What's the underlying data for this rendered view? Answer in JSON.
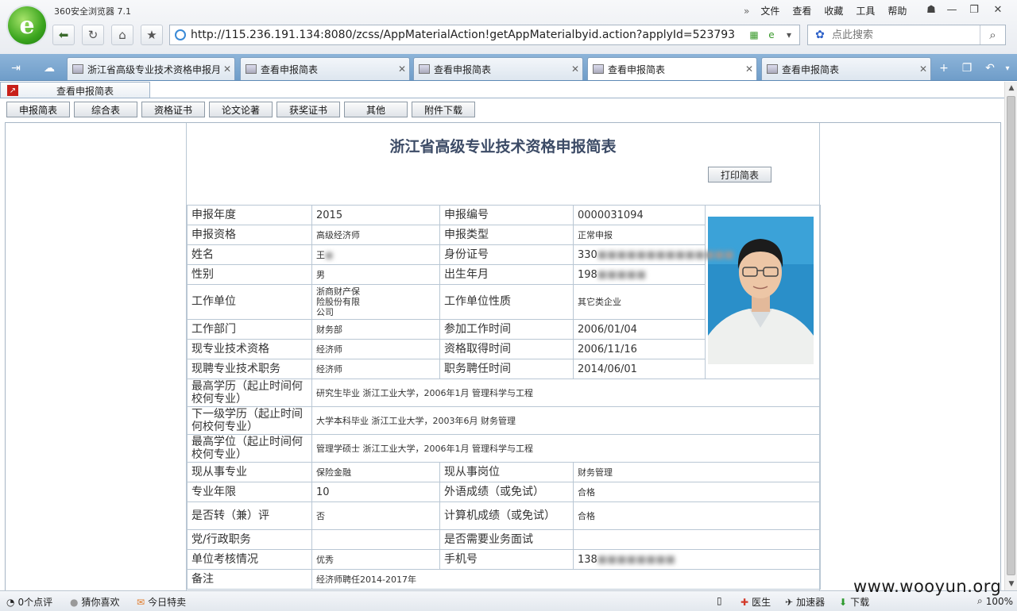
{
  "browser": {
    "app_name": "360安全浏览器 7.1",
    "menu": [
      "文件",
      "查看",
      "收藏",
      "工具",
      "帮助"
    ],
    "address": "http://115.236.191.134:8080/zcss/AppMaterialAction!getAppMaterialbyid.action?applyId=523793",
    "search_placeholder": "点此搜索",
    "tabs": [
      {
        "title": "浙江省高级专业技术资格申报月"
      },
      {
        "title": "查看申报简表"
      },
      {
        "title": "查看申报简表"
      },
      {
        "title": "查看申报简表"
      },
      {
        "title": "查看申报简表"
      }
    ],
    "active_tab": 3,
    "status": {
      "comments": "0个点评",
      "guess": "猜你喜欢",
      "today": "今日特卖",
      "doctor": "医生",
      "accelerator": "加速器",
      "download": "下载",
      "zoom": "100%"
    },
    "watermark": "www.wooyun.org"
  },
  "page": {
    "inner_tab": "查看申报简表",
    "subnav": [
      "申报简表",
      "综合表",
      "资格证书",
      "论文论著",
      "获奖证书",
      "其他",
      "附件下载"
    ],
    "heading": "浙江省高级专业技术资格申报简表",
    "print_label": "打印简表"
  },
  "form": {
    "year_label": "申报年度",
    "year": "2015",
    "no_label": "申报编号",
    "no": "0000031094",
    "qual_label": "申报资格",
    "qual": "高级经济师",
    "type_label": "申报类型",
    "type": "正常申报",
    "name_label": "姓名",
    "name": "王",
    "id_label": "身份证号",
    "id": "330",
    "sex_label": "性别",
    "sex": "男",
    "birth_label": "出生年月",
    "birth": "198",
    "unit_label": "工作单位",
    "unit": "浙商财产保险股份有限公司",
    "unit_type_label": "工作单位性质",
    "unit_type": "其它类企业",
    "dept_label": "工作部门",
    "dept": "财务部",
    "work_start_label": "参加工作时间",
    "work_start": "2006/01/04",
    "cur_qual_label": "现专业技术资格",
    "cur_qual": "经济师",
    "qual_date_label": "资格取得时间",
    "qual_date": "2006/11/16",
    "cur_post_label": "现聘专业技术职务",
    "cur_post": "经济师",
    "post_date_label": "职务聘任时间",
    "post_date": "2014/06/01",
    "edu_label": "最高学历（起止时间何校何专业）",
    "edu": "研究生毕业 浙江工业大学，2006年1月 管理科学与工程",
    "edu2_label": "下一级学历（起止时间何校何专业）",
    "edu2": "大学本科毕业 浙江工业大学，2003年6月 财务管理",
    "degree_label": "最高学位（起止时间何校何专业）",
    "degree": "管理学硕士 浙江工业大学，2006年1月 管理科学与工程",
    "major_label": "现从事专业",
    "major": "保险金融",
    "position_label": "现从事岗位",
    "position": "财务管理",
    "years_label": "专业年限",
    "years": "10",
    "lang_label": "外语成绩（或免试）",
    "lang": "合格",
    "transfer_label": "是否转（兼）评",
    "transfer": "否",
    "computer_label": "计算机成绩（或免试）",
    "computer": "合格",
    "party_label": "党/行政职务",
    "party": "",
    "interview_label": "是否需要业务面试",
    "interview": "",
    "assess_label": "单位考核情况",
    "assess": "优秀",
    "phone_label": "手机号",
    "phone": "138",
    "remark_label": "备注",
    "remark": "经济师聘任2014-2017年"
  }
}
